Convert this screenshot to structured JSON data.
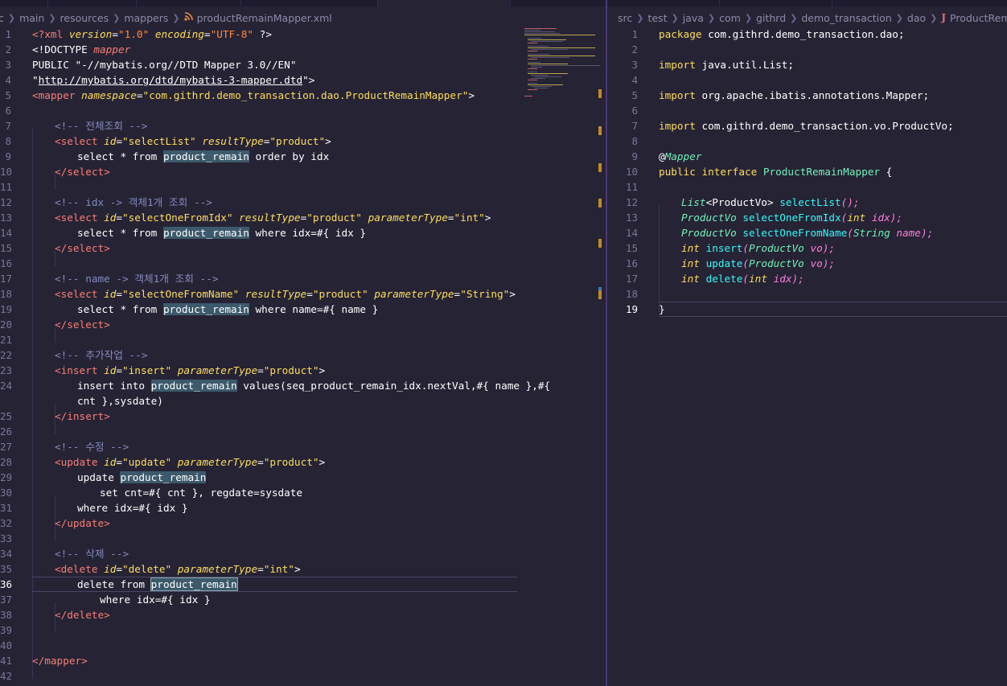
{
  "left_pane": {
    "breadcrumb": [
      "c",
      "main",
      "resources",
      "mappers"
    ],
    "file_name": "productRemainMapper.xml",
    "file_icon": "rss-icon",
    "current_line": 36,
    "lines": [
      {
        "n": "1"
      },
      {
        "n": "2"
      },
      {
        "n": "3"
      },
      {
        "n": "4"
      },
      {
        "n": "5"
      },
      {
        "n": "6"
      },
      {
        "n": "7"
      },
      {
        "n": "8"
      },
      {
        "n": "9"
      },
      {
        "n": "10"
      },
      {
        "n": "11"
      },
      {
        "n": "12"
      },
      {
        "n": "13"
      },
      {
        "n": "14"
      },
      {
        "n": "15"
      },
      {
        "n": "16"
      },
      {
        "n": "17"
      },
      {
        "n": "18"
      },
      {
        "n": "19"
      },
      {
        "n": "20"
      },
      {
        "n": "21"
      },
      {
        "n": "22"
      },
      {
        "n": "23"
      },
      {
        "n": "24"
      },
      {
        "n": ""
      },
      {
        "n": "25"
      },
      {
        "n": "26"
      },
      {
        "n": "27"
      },
      {
        "n": "28"
      },
      {
        "n": "29"
      },
      {
        "n": "30"
      },
      {
        "n": "31"
      },
      {
        "n": "32"
      },
      {
        "n": "33"
      },
      {
        "n": "34"
      },
      {
        "n": "35"
      },
      {
        "n": "36"
      },
      {
        "n": "37"
      },
      {
        "n": "38"
      },
      {
        "n": "39"
      },
      {
        "n": "40"
      },
      {
        "n": "41"
      },
      {
        "n": "42"
      }
    ],
    "code": {
      "l1_a": "<?xml ",
      "l1_b": "version",
      "l1_c": "=",
      "l1_d": "\"1.0\"",
      "l1_e": " ",
      "l1_f": "encoding",
      "l1_g": "=",
      "l1_h": "\"UTF-8\"",
      "l1_i": " ?>",
      "l2_a": "<!DOCTYPE ",
      "l2_b": "mapper",
      "l3": "PUBLIC \"-//mybatis.org//DTD Mapper 3.0//EN\"",
      "l4_a": "\"",
      "l4_b": "http://mybatis.org/dtd/mybatis-3-mapper.dtd",
      "l4_c": "\">",
      "l5_a": "<mapper ",
      "l5_b": "namespace",
      "l5_c": "=",
      "l5_d": "\"com.githrd.demo_transaction.dao.ProductRemainMapper\"",
      "l5_e": ">",
      "l7": "<!-- 전체조회 -->",
      "l8_a": "<select ",
      "l8_b": "id",
      "l8_c": "=",
      "l8_d": "\"selectList\"",
      "l8_e": " ",
      "l8_f": "resultType",
      "l8_g": "=",
      "l8_h": "\"product\"",
      "l8_i": ">",
      "l9_a": "select * from ",
      "l9_b": "product_remain",
      "l9_c": " order by idx",
      "l10": "</select>",
      "l12": "<!-- idx -> 객체1개 조회 -->",
      "l13_a": "<select ",
      "l13_b": "id",
      "l13_c": "=",
      "l13_d": "\"selectOneFromIdx\"",
      "l13_e": " ",
      "l13_f": "resultType",
      "l13_g": "=",
      "l13_h": "\"product\"",
      "l13_i": " ",
      "l13_j": "parameterType",
      "l13_k": "=",
      "l13_l": "\"int\"",
      "l13_m": ">",
      "l14_a": "select * from ",
      "l14_b": "product_remain",
      "l14_c": " where idx=#{ idx }",
      "l15": "</select>",
      "l17": "<!-- name -> 객체1개 조회 -->",
      "l18_a": "<select ",
      "l18_b": "id",
      "l18_c": "=",
      "l18_d": "\"selectOneFromName\"",
      "l18_e": " ",
      "l18_f": "resultType",
      "l18_g": "=",
      "l18_h": "\"product\"",
      "l18_i": " ",
      "l18_j": "parameterType",
      "l18_k": "=",
      "l18_l": "\"String\"",
      "l18_m": ">",
      "l19_a": "select * from ",
      "l19_b": "product_remain",
      "l19_c": " where name=#{ name }",
      "l20": "</select>",
      "l22": "<!-- 추가작업 -->",
      "l23_a": "<insert ",
      "l23_b": "id",
      "l23_c": "=",
      "l23_d": "\"insert\"",
      "l23_e": " ",
      "l23_f": "parameterType",
      "l23_g": "=",
      "l23_h": "\"product\"",
      "l23_i": ">",
      "l24_a": "insert into ",
      "l24_b": "product_remain",
      "l24_c": " values(seq_product_remain_idx.nextVal,#{ name },#{",
      "l24w": "cnt },sysdate)",
      "l25": "</insert>",
      "l27": "<!-- 수정 -->",
      "l28_a": "<update ",
      "l28_b": "id",
      "l28_c": "=",
      "l28_d": "\"update\"",
      "l28_e": " ",
      "l28_f": "parameterType",
      "l28_g": "=",
      "l28_h": "\"product\"",
      "l28_i": ">",
      "l29_a": "update ",
      "l29_b": "product_remain",
      "l30": "set cnt=#{ cnt }, regdate=sysdate",
      "l31": "where idx=#{ idx }",
      "l32": "</update>",
      "l34": "<!-- 삭제 -->",
      "l35_a": "<delete ",
      "l35_b": "id",
      "l35_c": "=",
      "l35_d": "\"delete\"",
      "l35_e": " ",
      "l35_f": "parameterType",
      "l35_g": "=",
      "l35_h": "\"int\"",
      "l35_i": ">",
      "l36_a": "delete from ",
      "l36_b": "product_remain",
      "l37": "where idx=#{ idx }",
      "l38": "</delete>",
      "l41": "</mapper>"
    }
  },
  "right_pane": {
    "breadcrumb": [
      "src",
      "test",
      "java",
      "com",
      "githrd",
      "demo_transaction",
      "dao"
    ],
    "file_name": "ProductRemainMapper.java",
    "file_icon": "java-icon",
    "current_line": 19,
    "lines": [
      {
        "n": "1"
      },
      {
        "n": "2"
      },
      {
        "n": "3"
      },
      {
        "n": "4"
      },
      {
        "n": "5"
      },
      {
        "n": "6"
      },
      {
        "n": "7"
      },
      {
        "n": "8"
      },
      {
        "n": "9"
      },
      {
        "n": "10"
      },
      {
        "n": "11"
      },
      {
        "n": "12"
      },
      {
        "n": "13"
      },
      {
        "n": "14"
      },
      {
        "n": "15"
      },
      {
        "n": "16"
      },
      {
        "n": "17"
      },
      {
        "n": "18"
      },
      {
        "n": "19"
      }
    ],
    "code": {
      "r1_a": "package",
      "r1_b": " com.githrd.demo_transaction.dao;",
      "r3_a": "import",
      "r3_b": " java.util.List;",
      "r5_a": "import",
      "r5_b": " org.apache.ibatis.annotations.Mapper;",
      "r7_a": "import",
      "r7_b": " com.githrd.demo_transaction.vo.ProductVo;",
      "r9_a": "@",
      "r9_b": "Mapper",
      "r10_a": "public",
      "r10_b": " ",
      "r10_c": "interface",
      "r10_d": " ",
      "r10_e": "ProductRemainMapper",
      "r10_f": " {",
      "r12_a": "List",
      "r12_b": "<ProductVo> ",
      "r12_c": "selectList",
      "r12_d": "();",
      "r13_a": "ProductVo",
      "r13_b": " ",
      "r13_c": "selectOneFromIdx",
      "r13_d": "(",
      "r13_e": "int",
      "r13_f": " ",
      "r13_g": "idx",
      "r13_h": ");",
      "r14_a": "ProductVo",
      "r14_b": " ",
      "r14_c": "selectOneFromName",
      "r14_d": "(",
      "r14_e": "String",
      "r14_f": " ",
      "r14_g": "name",
      "r14_h": ");",
      "r15_a": "int",
      "r15_b": " ",
      "r15_c": "insert",
      "r15_d": "(",
      "r15_e": "ProductVo",
      "r15_f": " ",
      "r15_g": "vo",
      "r15_h": ");",
      "r16_a": "int",
      "r16_b": " ",
      "r16_c": "update",
      "r16_d": "(",
      "r16_e": "ProductVo",
      "r16_f": " ",
      "r16_g": "vo",
      "r16_h": ");",
      "r17_a": "int",
      "r17_b": " ",
      "r17_c": "delete",
      "r17_d": "(",
      "r17_e": "int",
      "r17_f": " ",
      "r17_g": "idx",
      "r17_h": ");",
      "r19": "}"
    }
  },
  "theme": {
    "background": "#262335",
    "tag_color": "#f97e72",
    "attr_color": "#fede5d",
    "string_color": "#ff8b39",
    "comment_color": "#848bbd",
    "highlight_color": "#3c5a6b"
  }
}
